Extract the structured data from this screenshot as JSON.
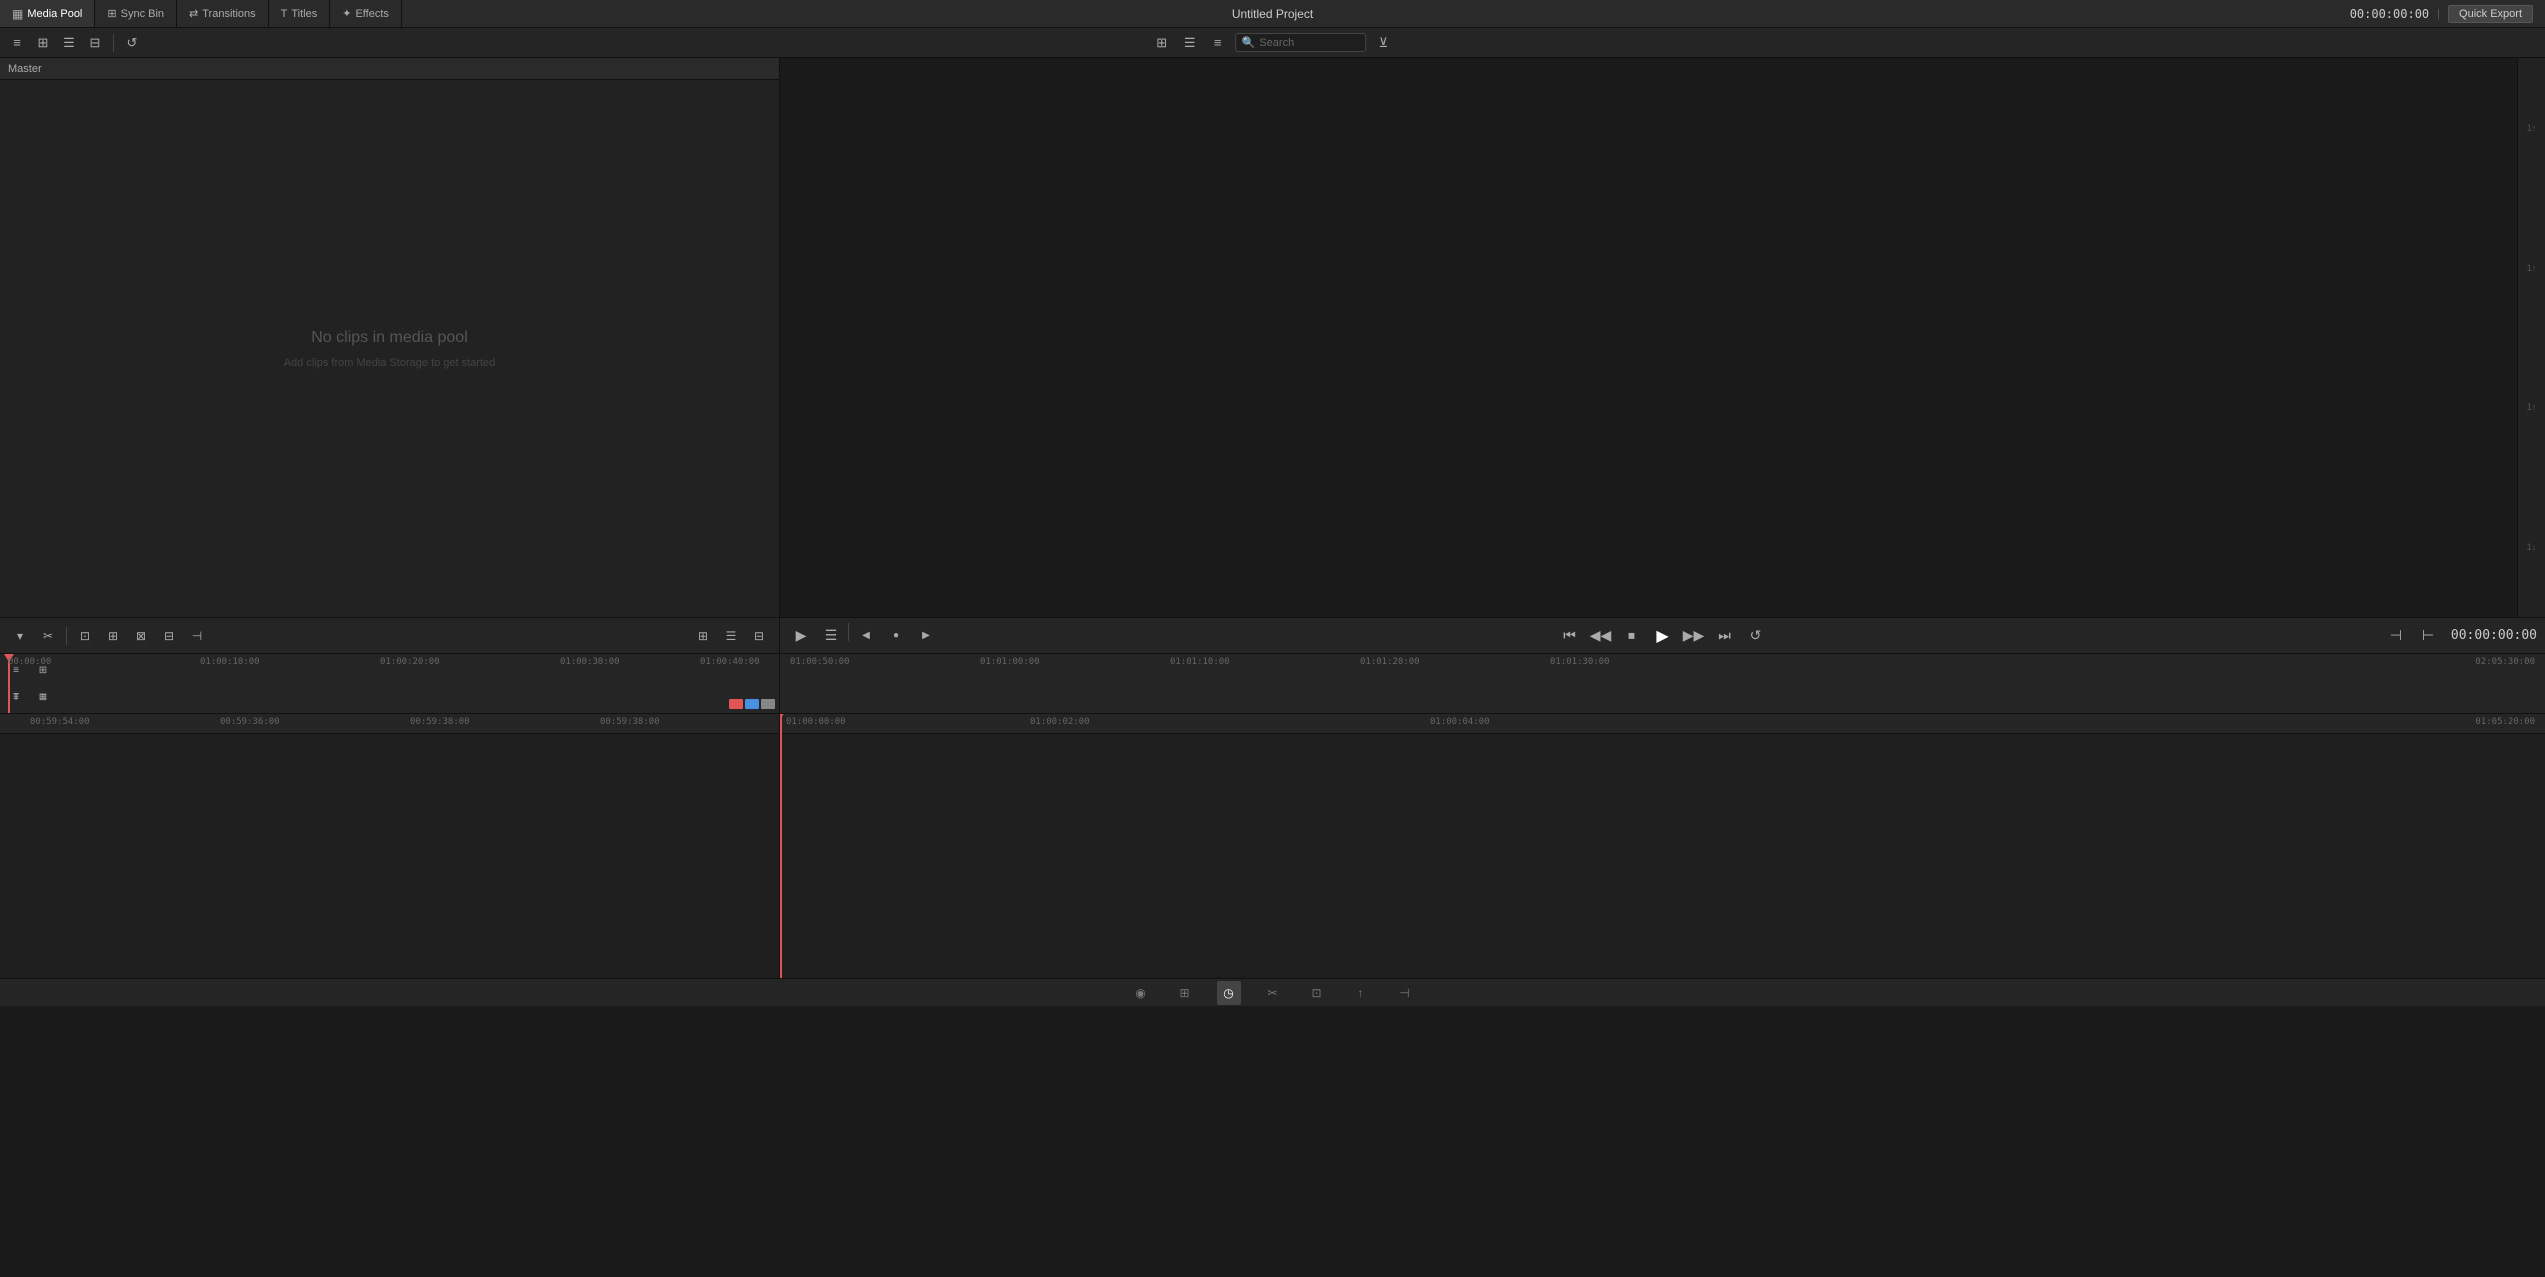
{
  "app": {
    "title": "Untitled Project",
    "quick_export_label": "Quick Export"
  },
  "top_nav": {
    "tabs": [
      {
        "id": "media-pool",
        "label": "Media Pool",
        "active": true
      },
      {
        "id": "sync-bin",
        "label": "Sync Bin",
        "active": false
      },
      {
        "id": "transitions",
        "label": "Transitions",
        "active": false
      },
      {
        "id": "titles",
        "label": "Titles",
        "active": false
      },
      {
        "id": "effects",
        "label": "Effects",
        "active": false
      }
    ],
    "timecode": "00:00:00:00"
  },
  "toolbar": {
    "view_icons": [
      "≡",
      "⊞",
      "☰",
      "⊟",
      "↺"
    ]
  },
  "search": {
    "placeholder": "Search"
  },
  "master_label": "Master",
  "media_pool": {
    "empty_title": "No clips in media pool",
    "empty_subtitle": "Add clips from Media Storage to get started"
  },
  "preview": {
    "timecode": "00:00:00:00",
    "right_labels": [
      "1↑",
      "1↑",
      "1↑",
      "1↓"
    ]
  },
  "transport": {
    "buttons": [
      "⏮",
      "◀",
      "⏹",
      "▶",
      "⏭",
      "↺"
    ],
    "timecode": "00:00:00:00"
  },
  "timeline": {
    "upper_ruler_marks": [
      "00:00:00",
      "01:00:10:00",
      "01:00:20:00",
      "01:00:30:00",
      "01:00:40:00",
      "01:00:50:00",
      "01:01:00:00",
      "01:01:10:00",
      "01:01:20:00",
      "01:01:30:00",
      "02:05:30:00"
    ],
    "lower_ruler_marks": [
      "00:59:54:00",
      "00:59:36:00",
      "00:59:38:00",
      "00:59:38:00",
      "01:00:00:00",
      "01:00:02:00",
      "01:00:04:00",
      "01:05:20:00"
    ],
    "playhead_upper_pos": "00:00:00",
    "playhead_lower_ts": "01:00:00:00"
  },
  "bottom_bar": {
    "buttons": [
      "◉",
      "⊞",
      "◷",
      "✂",
      "⊡",
      "↑",
      "⊣"
    ]
  }
}
